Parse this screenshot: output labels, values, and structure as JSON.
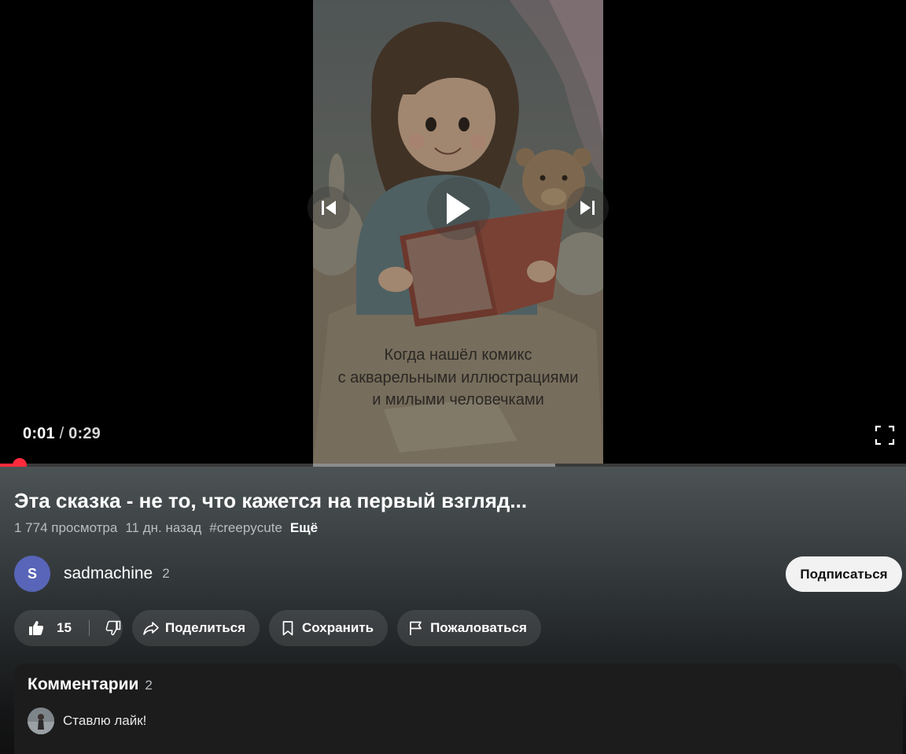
{
  "video": {
    "caption_lines": [
      "Когда нашёл комикс",
      "с акварельными иллюстрациями",
      "и милыми человечками"
    ],
    "current_time": "0:01",
    "separator": "/",
    "duration": "0:29",
    "progress_played": 0.02,
    "progress_buffered": 0.613
  },
  "info": {
    "title": "Эта сказка - не то, что кажется на первый взгляд...",
    "views": "1 774 просмотра",
    "age": "11 дн. назад",
    "hashtag": "#creepycute",
    "more_label": "Ещё"
  },
  "channel": {
    "avatar_letter": "S",
    "avatar_color": "#5865b8",
    "name": "sadmachine",
    "count": "2",
    "subscribe_label": "Подписаться"
  },
  "actions": {
    "likes_count": "15",
    "share_label": "Поделиться",
    "save_label": "Сохранить",
    "report_label": "Пожаловаться"
  },
  "comments": {
    "title": "Комментарии",
    "count": "2",
    "items": [
      {
        "text": "Ставлю лайк!"
      }
    ]
  },
  "colors": {
    "accent": "#ff2b3c",
    "panel": "#1c1c1c"
  }
}
